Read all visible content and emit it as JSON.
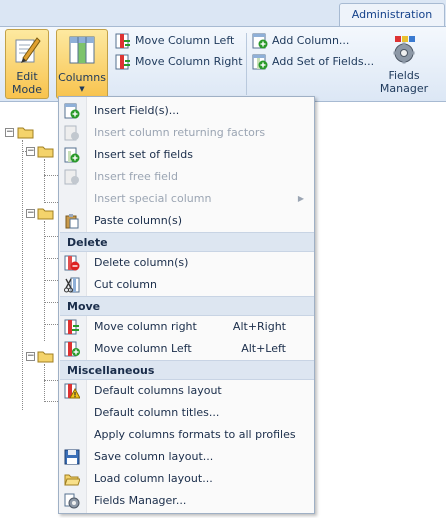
{
  "ribbon": {
    "tab_admin": "Administration",
    "edit_mode": [
      "Edit",
      "Mode"
    ],
    "columns": "Columns",
    "move_left": "Move Column Left",
    "move_right": "Move Column Right",
    "add_column": "Add Column...",
    "add_set": "Add Set of Fields...",
    "fields_manager": [
      "Fields",
      "Manager"
    ]
  },
  "menu": {
    "items": [
      {
        "label": "Insert Field(s)...",
        "enabled": true,
        "icon": "insert-field-icon"
      },
      {
        "label": "Insert column returning factors",
        "enabled": false,
        "icon": "factors-icon"
      },
      {
        "label": "Insert set of fields",
        "enabled": true,
        "icon": "insert-set-icon"
      },
      {
        "label": "Insert free field",
        "enabled": false,
        "icon": "free-field-icon"
      },
      {
        "label": "Insert special column",
        "enabled": false,
        "icon": "",
        "submenu": true
      },
      {
        "label": "Paste column(s)",
        "enabled": true,
        "icon": "paste-icon"
      }
    ],
    "delete_header": "Delete",
    "delete_items": [
      {
        "label": "Delete column(s)",
        "icon": "delete-column-icon"
      },
      {
        "label": "Cut column",
        "icon": "cut-icon"
      }
    ],
    "move_header": "Move",
    "move_items": [
      {
        "label": "Move column right",
        "shortcut": "Alt+Right",
        "icon": "move-right-icon"
      },
      {
        "label": "Move column Left",
        "shortcut": "Alt+Left",
        "icon": "move-left-icon"
      }
    ],
    "misc_header": "Miscellaneous",
    "misc_items": [
      {
        "label": "Default columns layout",
        "icon": "warning-icon"
      },
      {
        "label": "Default column titles...",
        "icon": ""
      },
      {
        "label": "Apply columns formats to all profiles",
        "icon": ""
      },
      {
        "label": "Save column layout...",
        "icon": "save-icon"
      },
      {
        "label": "Load column layout...",
        "icon": "open-folder-icon"
      },
      {
        "label": "Fields Manager...",
        "icon": "fields-manager-icon"
      }
    ]
  },
  "colors": {
    "ribbon_bg": "#dce7f5",
    "pressed": "#f8c34e",
    "header_bg": "#dde6f1",
    "disabled_text": "#9ba5b3"
  }
}
